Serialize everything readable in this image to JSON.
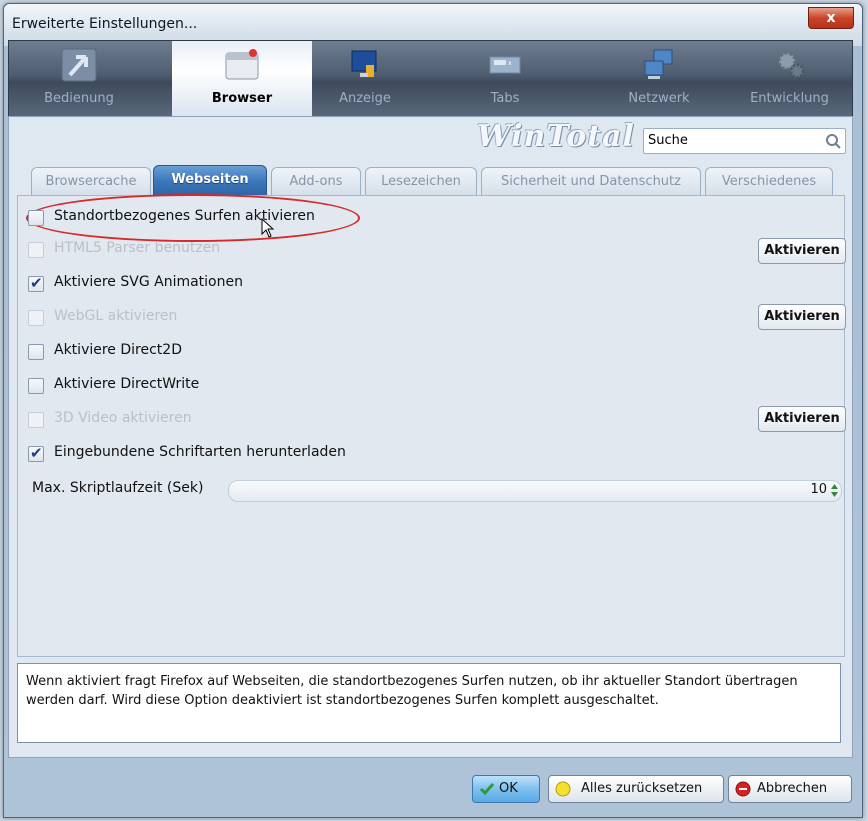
{
  "window": {
    "title": "Erweiterte Einstellungen...",
    "close_label": "x"
  },
  "maintabs": [
    {
      "label": "Bedienung",
      "icon": "pointer-arrow-icon",
      "active": false
    },
    {
      "label": "Browser",
      "icon": "browser-window-icon",
      "active": true
    },
    {
      "label": "Anzeige",
      "icon": "monitor-paint-icon",
      "active": false
    },
    {
      "label": "Tabs",
      "icon": "tabs-window-icon",
      "active": false
    },
    {
      "label": "Netzwerk",
      "icon": "network-computers-icon",
      "active": false
    },
    {
      "label": "Entwicklung",
      "icon": "gears-icon",
      "active": false
    }
  ],
  "brand": {
    "logo_text": "WinTotal"
  },
  "search": {
    "value": "Suche"
  },
  "subtabs": [
    {
      "label": "Browsercache",
      "active": false
    },
    {
      "label": "Webseiten",
      "active": true
    },
    {
      "label": "Add-ons",
      "active": false
    },
    {
      "label": "Lesezeichen",
      "active": false
    },
    {
      "label": "Sicherheit und Datenschutz",
      "active": false
    },
    {
      "label": "Verschiedenes",
      "active": false
    }
  ],
  "options": [
    {
      "label": "Standortbezogenes Surfen aktivieren",
      "checked": false,
      "disabled": false,
      "button": ""
    },
    {
      "label": "HTML5 Parser benutzen",
      "checked": false,
      "disabled": true,
      "button": "Aktivieren"
    },
    {
      "label": "Aktiviere SVG Animationen",
      "checked": true,
      "disabled": false,
      "button": ""
    },
    {
      "label": "WebGL aktivieren",
      "checked": false,
      "disabled": true,
      "button": "Aktivieren"
    },
    {
      "label": "Aktiviere Direct2D",
      "checked": false,
      "disabled": false,
      "button": ""
    },
    {
      "label": "Aktiviere DirectWrite",
      "checked": false,
      "disabled": false,
      "button": ""
    },
    {
      "label": "3D Video aktivieren",
      "checked": false,
      "disabled": true,
      "button": "Aktivieren"
    },
    {
      "label": "Eingebundene Schriftarten herunterladen",
      "checked": true,
      "disabled": false,
      "button": ""
    }
  ],
  "script_time": {
    "label": "Max. Skriptlaufzeit (Sek)",
    "value": "10"
  },
  "description": "Wenn aktiviert fragt Firefox auf Webseiten, die standortbezogenes Surfen nutzen, ob ihr aktueller Standort übertragen werden darf. Wird diese Option deaktiviert ist standortbezogenes Surfen komplett ausgeschaltet.",
  "buttons": {
    "ok": "OK",
    "reset": "Alles zurücksetzen",
    "cancel": "Abbrechen"
  },
  "colors": {
    "highlight_oval": "#d6292a",
    "active_tab": "#3b78bb",
    "check": "#1e3e84"
  }
}
